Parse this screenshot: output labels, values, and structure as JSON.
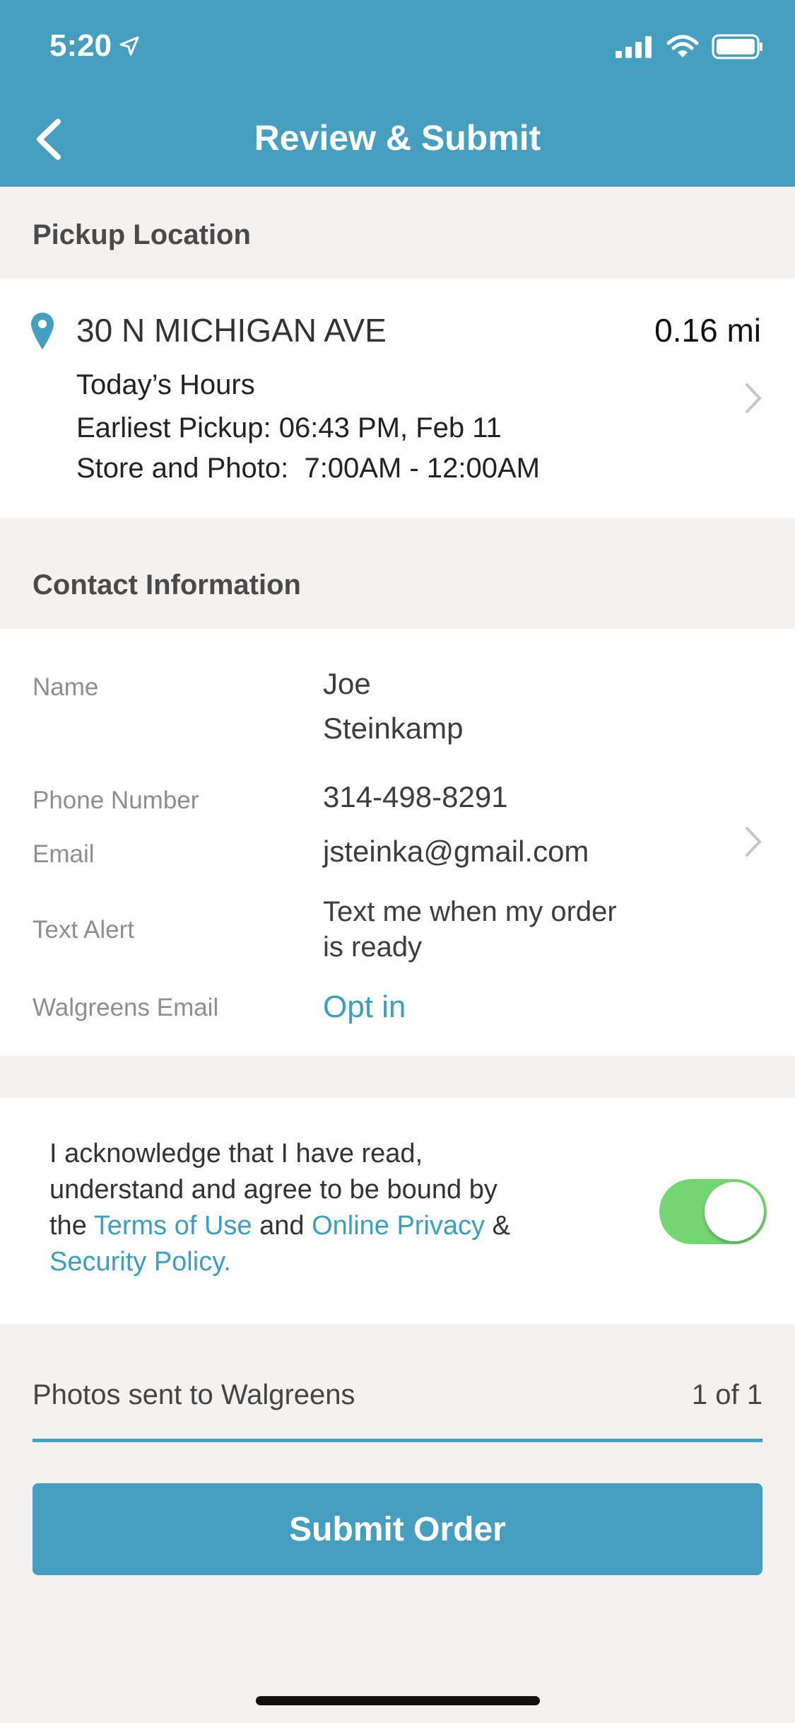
{
  "status_bar": {
    "time": "5:20"
  },
  "header": {
    "title": "Review & Submit"
  },
  "pickup": {
    "section_title": "Pickup Location",
    "address": "30 N MICHIGAN AVE",
    "distance": "0.16 mi",
    "hours_label": "Today’s Hours",
    "earliest_pickup": "Earliest Pickup: 06:43 PM, Feb 11",
    "store_hours": "Store and Photo:  7:00AM - 12:00AM"
  },
  "contact": {
    "section_title": "Contact Information",
    "name_label": "Name",
    "name_first": "Joe",
    "name_last": "Steinkamp",
    "phone_label": "Phone Number",
    "phone": "314-498-8291",
    "email_label": "Email",
    "email": "jsteinka@gmail.com",
    "text_alert_label": "Text Alert",
    "text_alert_line1": "Text me when my order",
    "text_alert_line2": "is ready",
    "walgreens_email_label": "Walgreens Email",
    "walgreens_email_value": "Opt in"
  },
  "terms": {
    "line1": "I acknowledge that I have read,",
    "line2": "understand and agree to be bound by",
    "the": "the",
    "terms_link": "Terms of Use",
    "and": "and",
    "privacy_link": "Online Privacy",
    "amp": "&",
    "security_link": "Security Policy.",
    "toggle_on": true
  },
  "photos": {
    "label": "Photos sent to Walgreens",
    "count": "1 of 1",
    "progress": 1.0
  },
  "submit_label": "Submit Order",
  "colors": {
    "accent": "#479fbf",
    "toggle_on": "#74d672",
    "link": "#3a9fc0"
  }
}
